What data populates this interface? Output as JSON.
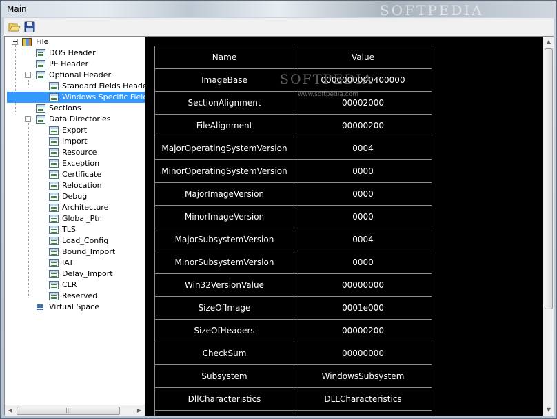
{
  "window": {
    "title": "Main",
    "watermark": "SOFTPEDIA"
  },
  "toolbar": {
    "open_icon": "folder-open-icon",
    "save_icon": "floppy-disk-icon"
  },
  "tree": {
    "root": "File",
    "dos_header": "DOS Header",
    "pe_header": "PE Header",
    "optional_header": "Optional Header",
    "standard_fields": "Standard Fields Header",
    "windows_fields": "Windows Specific Fields",
    "sections": "Sections",
    "data_directories": "Data Directories",
    "directories": [
      "Export",
      "Import",
      "Resource",
      "Exception",
      "Certificate",
      "Relocation",
      "Debug",
      "Architecture",
      "Global_Ptr",
      "TLS",
      "Load_Config",
      "Bound_Import",
      "IAT",
      "Delay_Import",
      "CLR",
      "Reserved"
    ],
    "virtual_space": "Virtual Space",
    "selected": "Windows Specific Fields"
  },
  "grid": {
    "headers": {
      "name": "Name",
      "value": "Value"
    },
    "rows": [
      {
        "name": "ImageBase",
        "value": "0000000000400000"
      },
      {
        "name": "SectionAlignment",
        "value": "00002000"
      },
      {
        "name": "FileAlignment",
        "value": "00000200"
      },
      {
        "name": "MajorOperatingSystemVersion",
        "value": "0004"
      },
      {
        "name": "MinorOperatingSystemVersion",
        "value": "0000"
      },
      {
        "name": "MajorImageVersion",
        "value": "0000"
      },
      {
        "name": "MinorImageVersion",
        "value": "0000"
      },
      {
        "name": "MajorSubsystemVersion",
        "value": "0004"
      },
      {
        "name": "MinorSubsystemVersion",
        "value": "0000"
      },
      {
        "name": "Win32VersionValue",
        "value": "00000000"
      },
      {
        "name": "SizeOfImage",
        "value": "0001e000"
      },
      {
        "name": "SizeOfHeaders",
        "value": "00000200"
      },
      {
        "name": "CheckSum",
        "value": "00000000"
      },
      {
        "name": "Subsystem",
        "value": "WindowsSubsystem"
      },
      {
        "name": "DllCharacteristics",
        "value": "DLLCharacteristics"
      }
    ]
  },
  "watermark_mid": {
    "text": "SOFTPEDIA",
    "url": "www.softpedia.com"
  },
  "colors": {
    "data_background": "#000000",
    "selection": "#3399ff",
    "grid_border": "#8f8f8f"
  }
}
